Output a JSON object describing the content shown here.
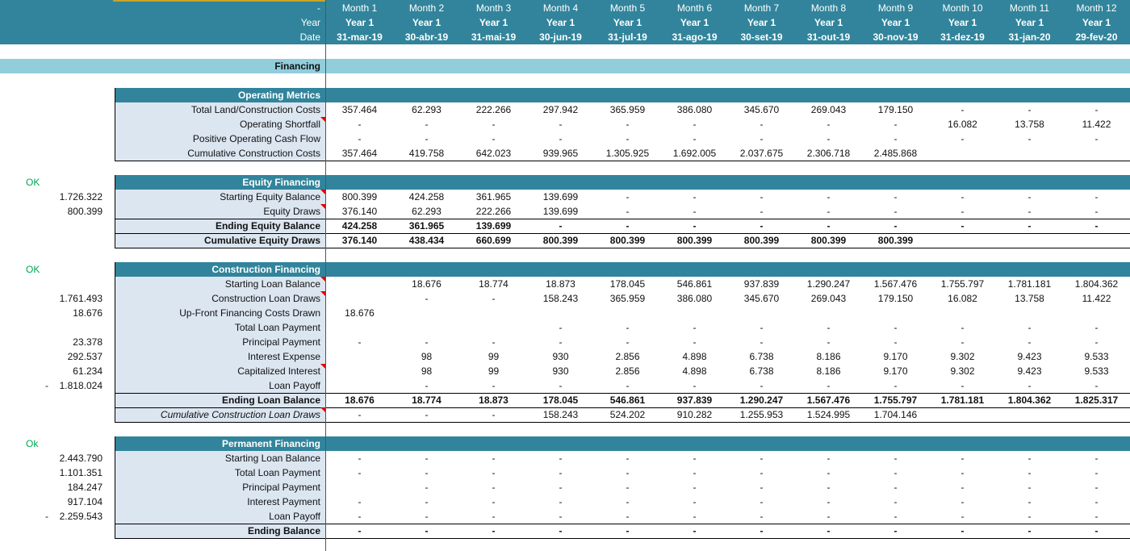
{
  "header": {
    "row_labels": [
      "-",
      "Year",
      "Date"
    ],
    "columns": [
      {
        "month": "Month 1",
        "year": "Year 1",
        "date": "31-mar-19"
      },
      {
        "month": "Month 2",
        "year": "Year 1",
        "date": "30-abr-19"
      },
      {
        "month": "Month 3",
        "year": "Year 1",
        "date": "31-mai-19"
      },
      {
        "month": "Month 4",
        "year": "Year 1",
        "date": "30-jun-19"
      },
      {
        "month": "Month 5",
        "year": "Year 1",
        "date": "31-jul-19"
      },
      {
        "month": "Month 6",
        "year": "Year 1",
        "date": "31-ago-19"
      },
      {
        "month": "Month 7",
        "year": "Year 1",
        "date": "30-set-19"
      },
      {
        "month": "Month 8",
        "year": "Year 1",
        "date": "31-out-19"
      },
      {
        "month": "Month 9",
        "year": "Year 1",
        "date": "30-nov-19"
      },
      {
        "month": "Month 10",
        "year": "Year 1",
        "date": "31-dez-19"
      },
      {
        "month": "Month 11",
        "year": "Year 1",
        "date": "31-jan-20"
      },
      {
        "month": "Month 12",
        "year": "Year 1",
        "date": "29-fev-20"
      }
    ]
  },
  "financing_title": "Financing",
  "sections": [
    {
      "id": "operating-metrics",
      "title": "Operating Metrics",
      "status": "",
      "rows": [
        {
          "label": "Total Land/Construction Costs",
          "left": "",
          "neg": false,
          "style": "",
          "comment": false,
          "values": [
            "357.464",
            "62.293",
            "222.266",
            "297.942",
            "365.959",
            "386.080",
            "345.670",
            "269.043",
            "179.150",
            "-",
            "-",
            "-"
          ]
        },
        {
          "label": "Operating Shortfall",
          "left": "",
          "neg": false,
          "style": "",
          "comment": true,
          "values": [
            "-",
            "-",
            "-",
            "-",
            "-",
            "-",
            "-",
            "-",
            "-",
            "16.082",
            "13.758",
            "11.422"
          ]
        },
        {
          "label": "Positive Operating Cash Flow",
          "left": "",
          "neg": false,
          "style": "",
          "comment": false,
          "values": [
            "-",
            "-",
            "-",
            "-",
            "-",
            "-",
            "-",
            "-",
            "-",
            "-",
            "-",
            "-"
          ]
        },
        {
          "label": "Cumulative Construction Costs",
          "left": "",
          "neg": false,
          "style": "",
          "comment": false,
          "values": [
            "357.464",
            "419.758",
            "642.023",
            "939.965",
            "1.305.925",
            "1.692.005",
            "2.037.675",
            "2.306.718",
            "2.485.868",
            "",
            "",
            ""
          ]
        }
      ]
    },
    {
      "id": "equity-financing",
      "title": "Equity Financing",
      "status": "OK",
      "rows": [
        {
          "label": "Starting Equity Balance",
          "left": "1.726.322",
          "neg": false,
          "style": "",
          "comment": true,
          "values": [
            "800.399",
            "424.258",
            "361.965",
            "139.699",
            "-",
            "-",
            "-",
            "-",
            "-",
            "-",
            "-",
            "-"
          ]
        },
        {
          "label": "Equity Draws",
          "left": "800.399",
          "neg": false,
          "style": "",
          "comment": true,
          "values": [
            "376.140",
            "62.293",
            "222.266",
            "139.699",
            "-",
            "-",
            "-",
            "-",
            "-",
            "-",
            "-",
            "-"
          ]
        },
        {
          "label": "Ending Equity Balance",
          "left": "",
          "neg": false,
          "style": "bold",
          "comment": false,
          "values": [
            "424.258",
            "361.965",
            "139.699",
            "-",
            "-",
            "-",
            "-",
            "-",
            "-",
            "-",
            "-",
            "-"
          ]
        },
        {
          "label": "Cumulative Equity Draws",
          "left": "",
          "neg": false,
          "style": "bold",
          "comment": false,
          "values": [
            "376.140",
            "438.434",
            "660.699",
            "800.399",
            "800.399",
            "800.399",
            "800.399",
            "800.399",
            "800.399",
            "",
            "",
            ""
          ]
        }
      ]
    },
    {
      "id": "construction-financing",
      "title": "Construction Financing",
      "status": "OK",
      "rows": [
        {
          "label": "Starting Loan Balance",
          "left": "",
          "neg": false,
          "style": "",
          "comment": true,
          "values": [
            "",
            "18.676",
            "18.774",
            "18.873",
            "178.045",
            "546.861",
            "937.839",
            "1.290.247",
            "1.567.476",
            "1.755.797",
            "1.781.181",
            "1.804.362"
          ]
        },
        {
          "label": "Construction Loan Draws",
          "left": "1.761.493",
          "neg": false,
          "style": "",
          "comment": true,
          "values": [
            "",
            "-",
            "-",
            "158.243",
            "365.959",
            "386.080",
            "345.670",
            "269.043",
            "179.150",
            "16.082",
            "13.758",
            "11.422"
          ]
        },
        {
          "label": "Up-Front Financing Costs Drawn",
          "left": "18.676",
          "neg": false,
          "style": "",
          "comment": false,
          "values": [
            "18.676",
            "",
            "",
            "",
            "",
            "",
            "",
            "",
            "",
            "",
            "",
            ""
          ]
        },
        {
          "label": "Total Loan Payment",
          "left": "",
          "neg": false,
          "style": "",
          "comment": false,
          "values": [
            "",
            "",
            "",
            "-",
            "-",
            "-",
            "-",
            "-",
            "-",
            "-",
            "-",
            "-"
          ]
        },
        {
          "label": "Principal Payment",
          "left": "23.378",
          "neg": false,
          "style": "",
          "comment": false,
          "values": [
            "-",
            "-",
            "-",
            "-",
            "-",
            "-",
            "-",
            "-",
            "-",
            "-",
            "-",
            "-"
          ]
        },
        {
          "label": "Interest Expense",
          "left": "292.537",
          "neg": false,
          "style": "",
          "comment": false,
          "values": [
            "",
            "98",
            "99",
            "930",
            "2.856",
            "4.898",
            "6.738",
            "8.186",
            "9.170",
            "9.302",
            "9.423",
            "9.533"
          ]
        },
        {
          "label": "Capitalized Interest",
          "left": "61.234",
          "neg": false,
          "style": "",
          "comment": true,
          "values": [
            "",
            "98",
            "99",
            "930",
            "2.856",
            "4.898",
            "6.738",
            "8.186",
            "9.170",
            "9.302",
            "9.423",
            "9.533"
          ]
        },
        {
          "label": "Loan Payoff",
          "left": "1.818.024",
          "neg": true,
          "style": "",
          "comment": false,
          "values": [
            "",
            "-",
            "-",
            "-",
            "-",
            "-",
            "-",
            "-",
            "-",
            "-",
            "-",
            "-"
          ]
        },
        {
          "label": "Ending Loan Balance",
          "left": "",
          "neg": false,
          "style": "bold",
          "comment": false,
          "values": [
            "18.676",
            "18.774",
            "18.873",
            "178.045",
            "546.861",
            "937.839",
            "1.290.247",
            "1.567.476",
            "1.755.797",
            "1.781.181",
            "1.804.362",
            "1.825.317"
          ]
        },
        {
          "label": "Cumulative Construction Loan Draws",
          "left": "",
          "neg": false,
          "style": "ital",
          "comment": true,
          "values": [
            "-",
            "-",
            "-",
            "158.243",
            "524.202",
            "910.282",
            "1.255.953",
            "1.524.995",
            "1.704.146",
            "",
            "",
            ""
          ]
        }
      ]
    },
    {
      "id": "permanent-financing",
      "title": "Permanent Financing",
      "status": "Ok",
      "rows": [
        {
          "label": "Starting Loan Balance",
          "left": "2.443.790",
          "neg": false,
          "style": "",
          "comment": false,
          "values": [
            "-",
            "-",
            "-",
            "-",
            "-",
            "-",
            "-",
            "-",
            "-",
            "-",
            "-",
            "-"
          ]
        },
        {
          "label": "Total Loan Payment",
          "left": "1.101.351",
          "neg": false,
          "style": "",
          "comment": false,
          "values": [
            "-",
            "-",
            "-",
            "-",
            "-",
            "-",
            "-",
            "-",
            "-",
            "-",
            "-",
            "-"
          ]
        },
        {
          "label": "Principal Payment",
          "left": "184.247",
          "neg": false,
          "style": "",
          "comment": false,
          "values": [
            "",
            "-",
            "-",
            "-",
            "-",
            "-",
            "-",
            "-",
            "-",
            "-",
            "-",
            "-"
          ]
        },
        {
          "label": "Interest Payment",
          "left": "917.104",
          "neg": false,
          "style": "",
          "comment": false,
          "values": [
            "-",
            "-",
            "-",
            "-",
            "-",
            "-",
            "-",
            "-",
            "-",
            "-",
            "-",
            "-"
          ]
        },
        {
          "label": "Loan Payoff",
          "left": "2.259.543",
          "neg": true,
          "style": "",
          "comment": false,
          "values": [
            "-",
            "-",
            "-",
            "-",
            "-",
            "-",
            "-",
            "-",
            "-",
            "-",
            "-",
            "-"
          ]
        },
        {
          "label": "Ending Balance",
          "left": "",
          "neg": false,
          "style": "bold",
          "comment": false,
          "values": [
            "-",
            "-",
            "-",
            "-",
            "-",
            "-",
            "-",
            "-",
            "-",
            "-",
            "-",
            "-"
          ]
        }
      ]
    }
  ],
  "colors": {
    "header": "#31849b",
    "band": "#92cddc",
    "label_bg": "#dce6f1",
    "ok": "#00a651",
    "comment": "#e00000"
  }
}
